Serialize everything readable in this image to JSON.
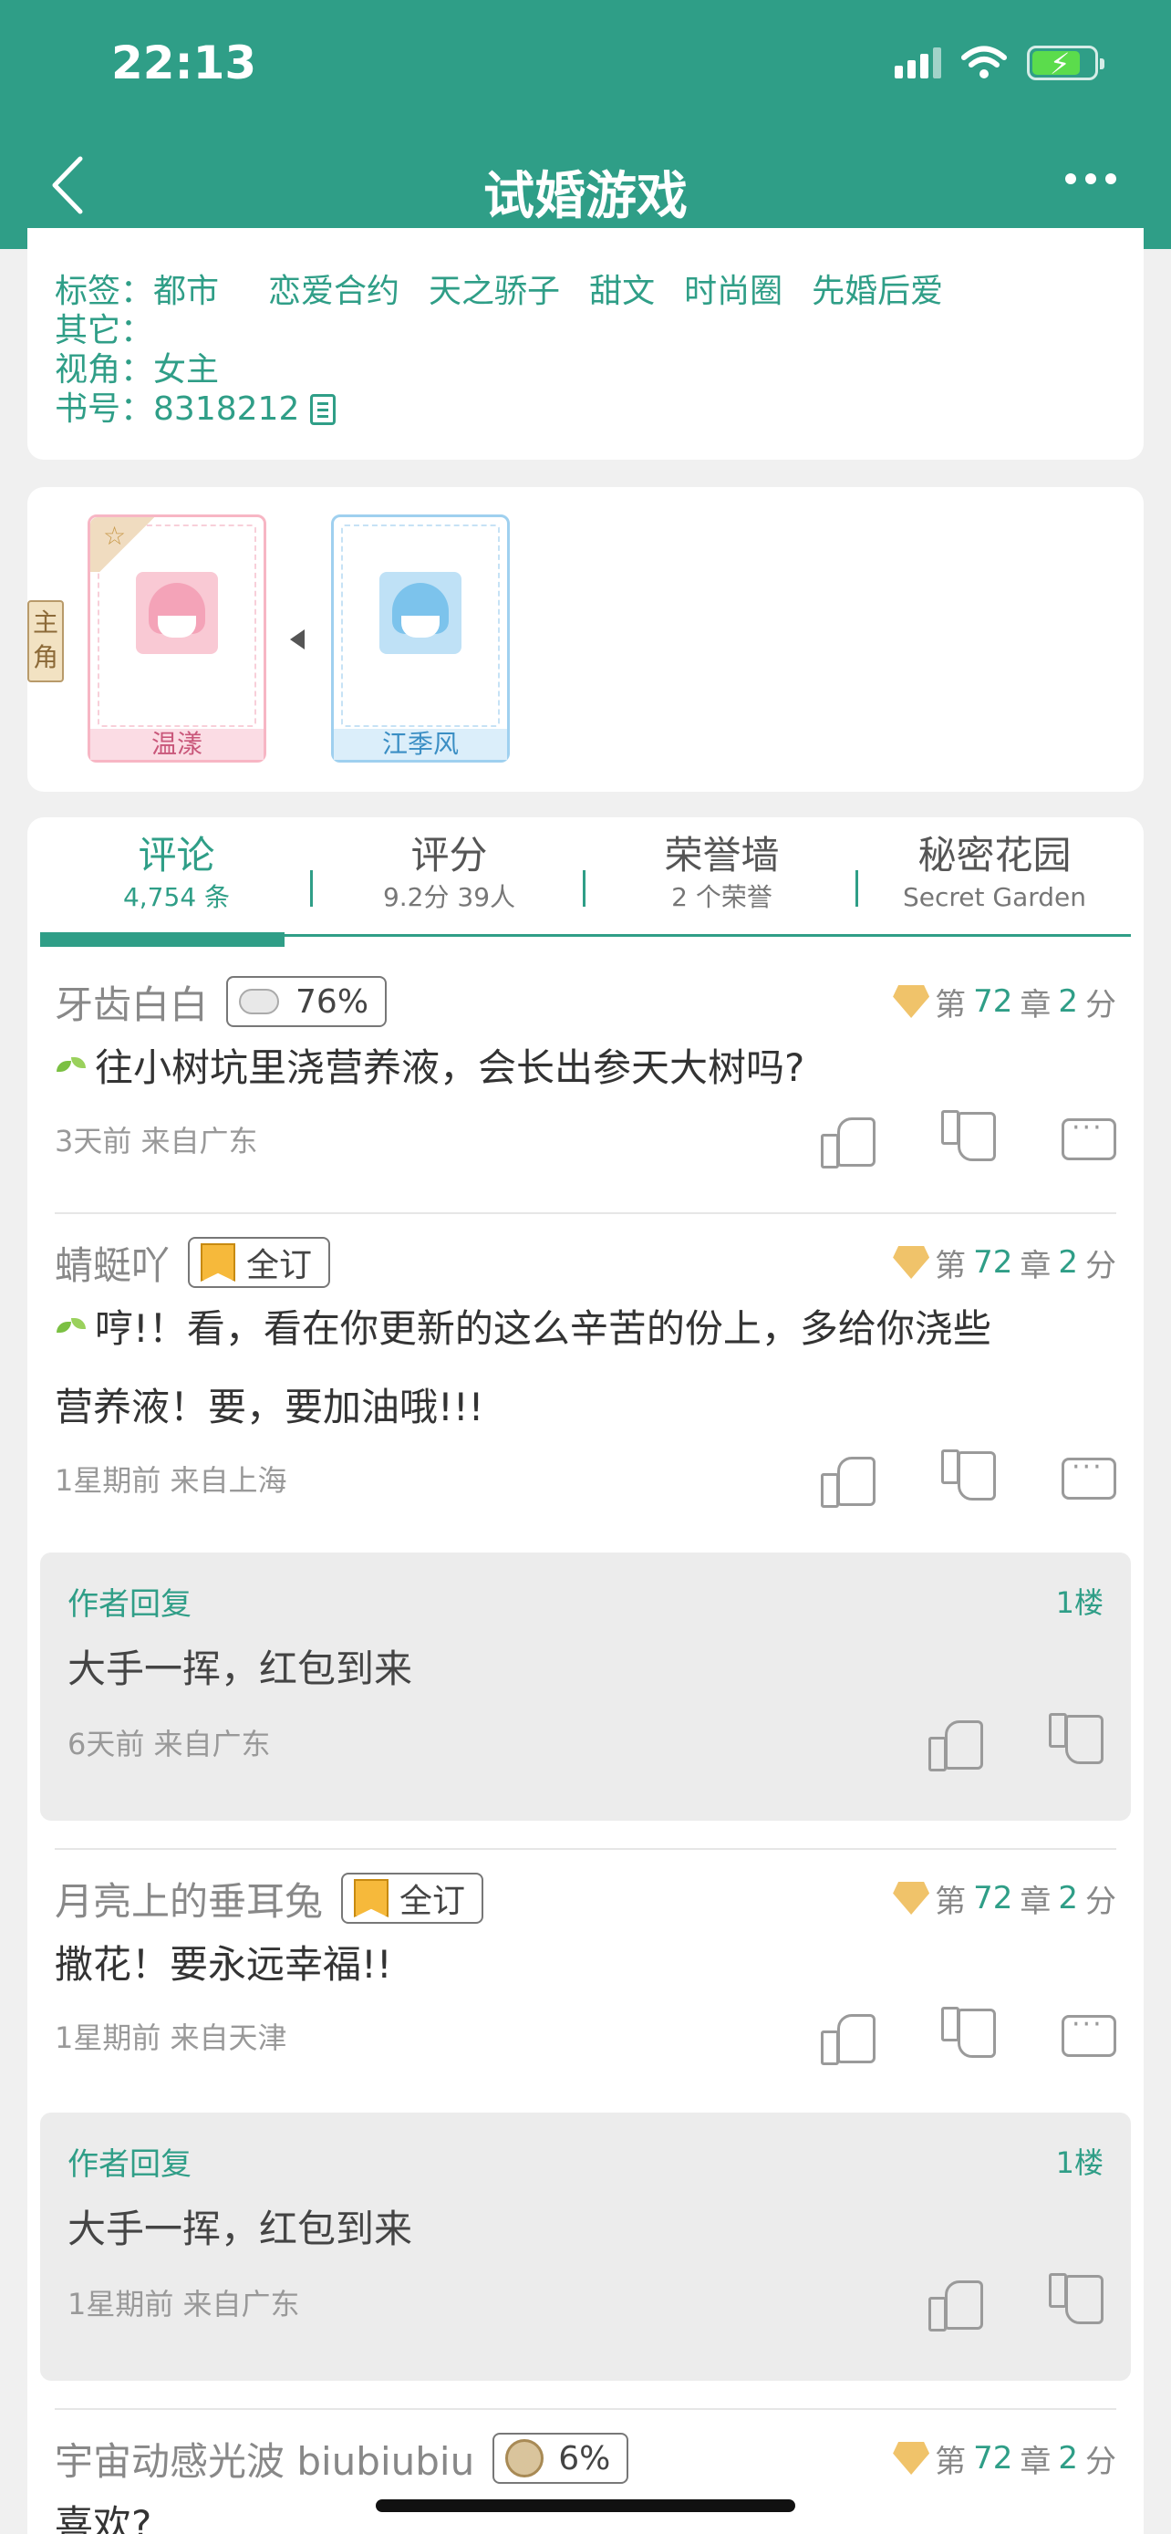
{
  "status": {
    "time": "22:13"
  },
  "nav": {
    "title": "试婚游戏"
  },
  "info": {
    "tags_label": "标签：",
    "tags": [
      "都市",
      "恋爱合约",
      "天之骄子",
      "甜文",
      "时尚圈",
      "先婚后爱"
    ],
    "other_label": "其它：",
    "other_value": "",
    "pov_label": "视角：",
    "pov_value": "女主",
    "book_no_label": "书号：",
    "book_no_value": "8318212"
  },
  "roles": {
    "tag_label": "主角",
    "characters": [
      {
        "name": "温漾"
      },
      {
        "name": "江季风"
      }
    ]
  },
  "tabs": [
    {
      "title": "评论",
      "sub": "4,754 条"
    },
    {
      "title": "评分",
      "sub": "9.2分 39人"
    },
    {
      "title": "荣誉墙",
      "sub": "2 个荣誉"
    },
    {
      "title": "秘密花园",
      "sub": "Secret Garden"
    }
  ],
  "comments": [
    {
      "user": "牙齿白白",
      "badge": "76%",
      "chapter_prefix": "第",
      "chapter": "72",
      "chapter_mid": "章",
      "score": "2",
      "score_unit": "分",
      "text": "往小树坑里浇营养液，会长出参天大树吗?",
      "meta": "3天前  来自广东"
    },
    {
      "user": "蜻蜓吖",
      "badge": "全订",
      "chapter_prefix": "第",
      "chapter": "72",
      "chapter_mid": "章",
      "score": "2",
      "score_unit": "分",
      "text_line1": "哼!！看，看在你更新的这么辛苦的份上，多给你浇些",
      "text_line2": "营养液！要，要加油哦!!!",
      "meta": "1星期前  来自上海",
      "reply": {
        "label": "作者回复",
        "floor": "1楼",
        "text": "大手一挥，红包到来",
        "meta": "6天前  来自广东"
      }
    },
    {
      "user": "月亮上的垂耳兔",
      "badge": "全订",
      "chapter_prefix": "第",
      "chapter": "72",
      "chapter_mid": "章",
      "score": "2",
      "score_unit": "分",
      "text": "撒花！要永远幸福!!",
      "meta": "1星期前  来自天津",
      "reply": {
        "label": "作者回复",
        "floor": "1楼",
        "text": "大手一挥，红包到来",
        "meta": "1星期前  来自广东"
      }
    },
    {
      "user": "宇宙动感光波 biubiubiu",
      "badge": "6%",
      "chapter_prefix": "第",
      "chapter": "72",
      "chapter_mid": "章",
      "score": "2",
      "score_unit": "分",
      "text": "喜欢?"
    }
  ]
}
